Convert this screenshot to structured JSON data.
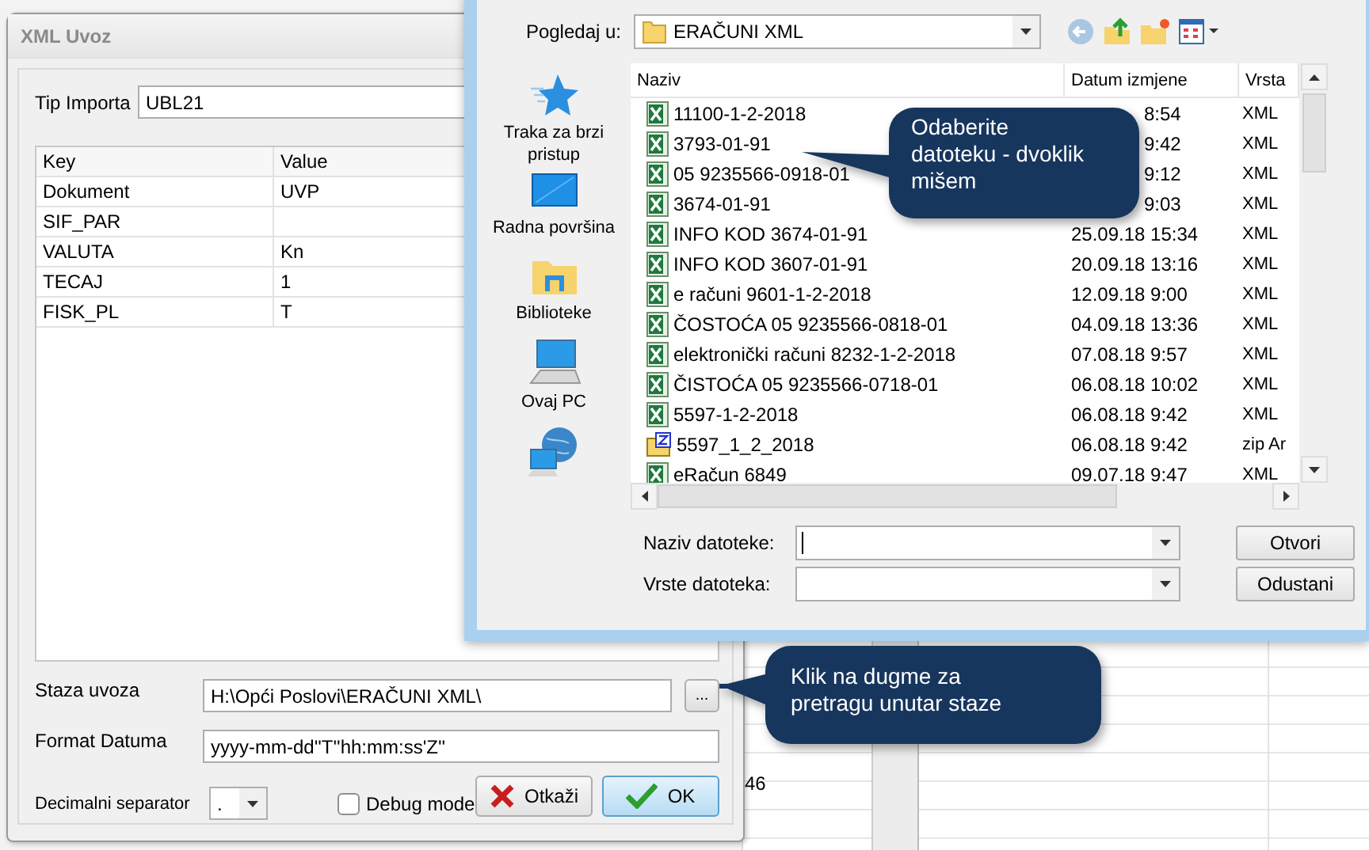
{
  "background": {
    "cell_text": "46"
  },
  "xml_window": {
    "title": "XML Uvoz",
    "tip_label": "Tip Importa",
    "tip_value": "UBL21",
    "grid": {
      "columns": [
        "Key",
        "Value"
      ],
      "rows": [
        {
          "key": "Dokument",
          "value": "UVP"
        },
        {
          "key": "SIF_PAR"
        },
        {
          "key": "VALUTA",
          "value": "Kn"
        },
        {
          "key": "TECAJ",
          "value": "1"
        },
        {
          "key": "FISK_PL",
          "value": "T"
        }
      ]
    },
    "path_label": "Staza uvoza",
    "path_value": "H:\\Opći Poslovi\\ERAČUNI XML\\",
    "browse_button": "...",
    "format_label": "Format Datuma",
    "format_value": "yyyy-mm-dd''T''hh:mm:ss'Z''",
    "decimal_label": "Decimalni separator",
    "decimal_value": ".",
    "debug": {
      "label": "Debug mode",
      "checked": false
    },
    "buttons": [
      {
        "label": "Otkaži",
        "kind": "cancel"
      },
      {
        "label": "OK",
        "kind": "ok"
      }
    ]
  },
  "file_dialog": {
    "look_in_label": "Pogledaj u:",
    "look_in_value": "ERAČUNI XML",
    "places": [
      {
        "label": "Traka za brzi pristup",
        "kind": "star"
      },
      {
        "label": "Radna površina",
        "kind": "desktop"
      },
      {
        "label": "Biblioteke",
        "kind": "library"
      },
      {
        "label": "Ovaj PC",
        "kind": "pc"
      },
      {
        "kind": "network"
      }
    ],
    "columns": [
      "Naziv",
      "Datum izmjene",
      "Vrsta"
    ],
    "files": [
      {
        "name": "11100-1-2-2018",
        "date": "8:54",
        "covered": true,
        "type": "XML",
        "kind": "xml"
      },
      {
        "name": "3793-01-91",
        "date": "9:42",
        "covered": true,
        "type": "XML",
        "kind": "xml"
      },
      {
        "name": "05 9235566-0918-01",
        "date": "9:12",
        "covered": true,
        "type": "XML",
        "kind": "xml"
      },
      {
        "name": "3674-01-91",
        "date": "9:03",
        "covered": true,
        "type": "XML",
        "kind": "xml"
      },
      {
        "name": "INFO KOD 3674-01-91",
        "date": "25.09.18 15:34",
        "covered": false,
        "type": "XML",
        "kind": "xml"
      },
      {
        "name": "INFO KOD 3607-01-91",
        "date": "20.09.18 13:16",
        "covered": false,
        "type": "XML",
        "kind": "xml"
      },
      {
        "name": "e računi 9601-1-2-2018",
        "date": "12.09.18 9:00",
        "covered": false,
        "type": "XML",
        "kind": "xml"
      },
      {
        "name": "ČOSTOĆA 05 9235566-0818-01",
        "date": "04.09.18 13:36",
        "covered": false,
        "type": "XML",
        "kind": "xml"
      },
      {
        "name": "elektronički računi 8232-1-2-2018",
        "date": "07.08.18 9:57",
        "covered": false,
        "type": "XML",
        "kind": "xml"
      },
      {
        "name": "ČISTOĆA 05 9235566-0718-01",
        "date": "06.08.18 10:02",
        "covered": false,
        "type": "XML",
        "kind": "xml"
      },
      {
        "name": "5597-1-2-2018",
        "date": "06.08.18 9:42",
        "covered": false,
        "type": "XML",
        "kind": "xml"
      },
      {
        "name": "5597_1_2_2018",
        "date": "06.08.18 9:42",
        "covered": false,
        "type": "zip Ar",
        "kind": "zip"
      },
      {
        "name": "eRačun 6849",
        "date": "09.07.18 9:47",
        "covered": false,
        "type": "XML",
        "kind": "xml"
      }
    ],
    "name_label": "Naziv datoteke:",
    "type_label": "Vrste datoteka:",
    "buttons": [
      "Otvori",
      "Odustani"
    ]
  },
  "callouts": [
    {
      "lines": [
        "Odaberite",
        "datoteku - dvoklik",
        "mišem"
      ]
    },
    {
      "lines": [
        "Klik na dugme za",
        "pretragu unutar staze"
      ]
    }
  ]
}
